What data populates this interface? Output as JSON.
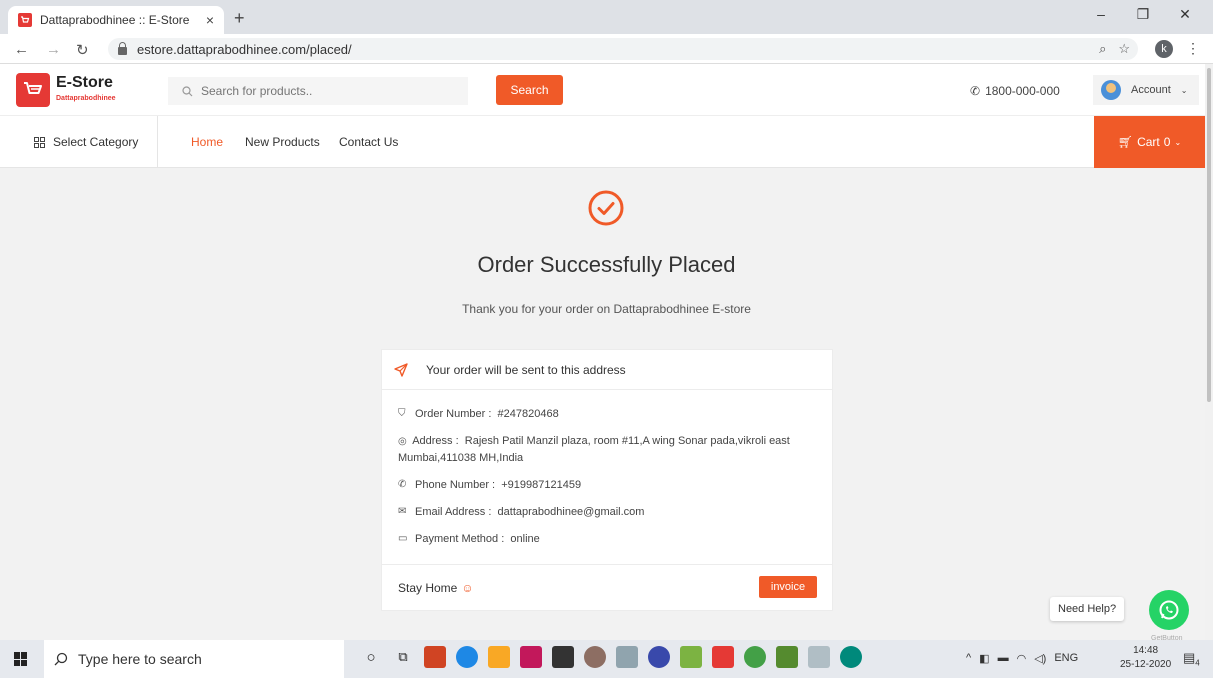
{
  "browser": {
    "tab_title": "Dattaprabodhinee :: E-Store",
    "tab_close": "×",
    "new_tab": "+",
    "url": "estore.dattaprabodhinee.com/placed/",
    "profile_initial": "k",
    "minimize": "–",
    "restore": "❐",
    "close": "✕"
  },
  "header": {
    "logo_title": "E-Store",
    "logo_subtitle": "Dattaprabodhinee",
    "search_placeholder": "Search for products..",
    "search_button": "Search",
    "phone": "1800-000-000",
    "account_label": "Account"
  },
  "nav": {
    "select_category": "Select Category",
    "links": [
      "Home",
      "New Products",
      "Contact Us"
    ],
    "cart_label": "Cart",
    "cart_count": "0"
  },
  "main": {
    "title": "Order Successfully Placed",
    "subtitle": "Thank you for your order on Dattaprabodhinee E-store",
    "card_header": "Your order will be sent to this address",
    "order_number_label": "Order Number :",
    "order_number": "#247820468",
    "address_label": "Address :",
    "address": "Rajesh Patil Manzil plaza, room #11,A wing Sonar pada,vikroli east Mumbai,411038 MH,India",
    "phone_label": "Phone Number :",
    "phone": "+919987121459",
    "email_label": "Email Address :",
    "email": "dattaprabodhinee@gmail.com",
    "payment_label": "Payment Method :",
    "payment": "online",
    "stay_home": "Stay Home",
    "invoice_button": "invoice"
  },
  "whatsapp": {
    "need_help": "Need Help?",
    "brand": "GetButton"
  },
  "taskbar": {
    "search_placeholder": "Type here to search",
    "lang": "ENG",
    "time": "14:48",
    "date": "25-12-2020",
    "notifications": "4"
  },
  "colors": {
    "accent": "#f05a28",
    "logo": "#e53935",
    "whatsapp": "#25d366"
  }
}
